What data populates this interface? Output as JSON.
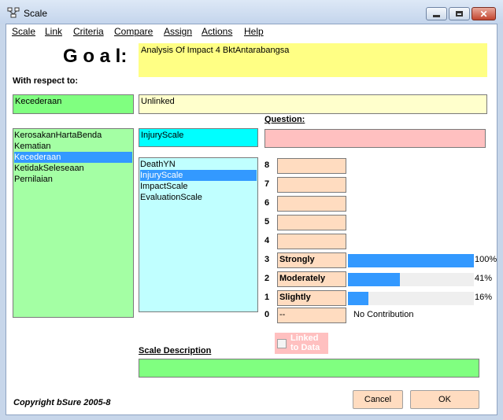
{
  "window": {
    "title": "Scale"
  },
  "menu": [
    "Scale",
    "Link",
    "Criteria",
    "Compare",
    "Assign",
    "Actions",
    "Help"
  ],
  "goal": {
    "label": "G o a l:",
    "text": "Analysis Of Impact 4 BktAntarabangsa"
  },
  "respect": {
    "label": "With respect to:",
    "value": "Kecederaan",
    "link": "Unlinked"
  },
  "criteria_list": {
    "items": [
      "KerosakanHartaBenda",
      "Kematian",
      "Kecederaan",
      "KetidakSeleseaan",
      "Pernilaian"
    ],
    "selected": 2
  },
  "scale": {
    "name": "InjuryScale",
    "items": [
      "DeathYN",
      "InjuryScale",
      "ImpactScale",
      "EvaluationScale"
    ],
    "selected": 1
  },
  "question": {
    "label": "Question:",
    "value": ""
  },
  "levels": [
    {
      "n": "8",
      "label": "",
      "pct": null
    },
    {
      "n": "7",
      "label": "",
      "pct": null
    },
    {
      "n": "6",
      "label": "",
      "pct": null
    },
    {
      "n": "5",
      "label": "",
      "pct": null
    },
    {
      "n": "4",
      "label": "",
      "pct": null
    },
    {
      "n": "3",
      "label": "Strongly",
      "pct": 100,
      "pct_text": "100%"
    },
    {
      "n": "2",
      "label": "Moderately",
      "pct": 41,
      "pct_text": "41%"
    },
    {
      "n": "1",
      "label": "Slightly",
      "pct": 16,
      "pct_text": "16%"
    }
  ],
  "zero_level": {
    "n": "0",
    "label": "--",
    "note": "No Contribution"
  },
  "linked": {
    "label_line1": "Linked",
    "label_line2": "to Data",
    "checked": false
  },
  "scale_description": {
    "label": "Scale Description",
    "value": ""
  },
  "copyright": "Copyright bSure 2005-8",
  "buttons": {
    "cancel": "Cancel",
    "ok": "OK"
  },
  "colors": {
    "accent": "#3399ff",
    "goal_bg": "#ffff84",
    "list_green": "#a4ffa4",
    "list_cyan": "#c0ffff",
    "question_pink": "#ffc0c0",
    "level_peach": "#ffdcc0"
  }
}
